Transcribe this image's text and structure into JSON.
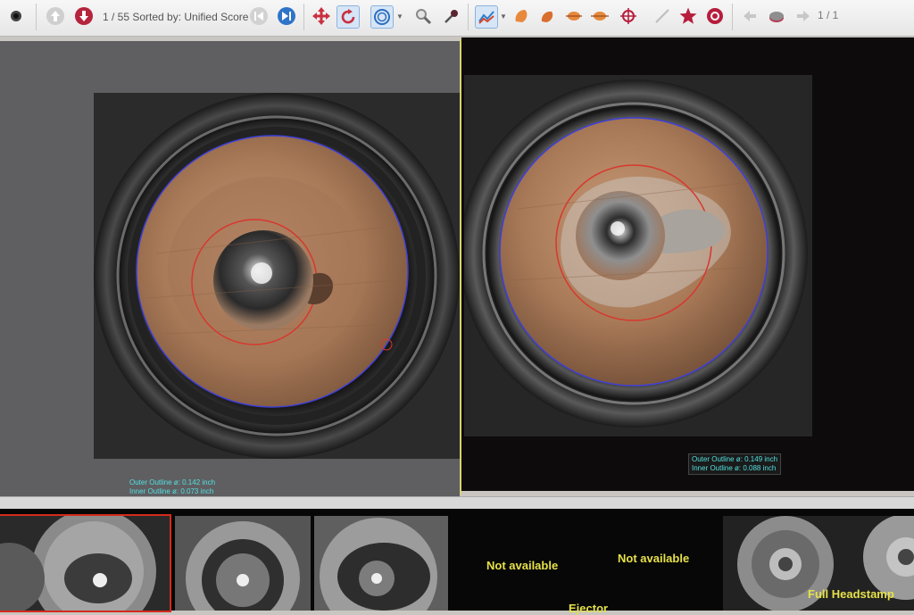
{
  "toolbar": {
    "status": "1 / 55 Sorted by: Unified Score",
    "page_count": "1 / 1",
    "icons": [
      "record-icon",
      "up-arrow-icon",
      "down-arrow-icon",
      "first-icon",
      "next-icon",
      "move-icon",
      "rotate-icon",
      "circle-outline-icon",
      "zoom-icon",
      "probe-icon",
      "chart-icon",
      "feature-icon",
      "feature-icon",
      "feature-icon",
      "feature-icon",
      "target-icon",
      "line-icon",
      "star-icon",
      "help-icon",
      "back-icon",
      "eraser-icon",
      "forward-icon"
    ],
    "colors": {
      "down_red": "#b5233d",
      "next_blue": "#2f74c8",
      "move_red": "#c8313f",
      "star_red": "#b61e3c",
      "feature_orange": "#e8883c"
    }
  },
  "left_scan": {
    "outer_outline": "Outer Outline ø: 0.142 inch",
    "inner_outline": "Inner Outline ø: 0.073 inch"
  },
  "right_scan": {
    "outer_outline": "Outer Outline ø: 0.149 inch",
    "inner_outline": "Inner Outline ø: 0.088 inch"
  },
  "thumbnails": {
    "not_available_1": "Not available",
    "not_available_2": "Not available",
    "ejector": "Ejector",
    "full_headstamp": "Full Headstamp"
  },
  "colors": {
    "outline_blue": "#3f3fd8",
    "outline_red": "#d8372e",
    "measure_text": "#54e0e0",
    "label_yellow": "#e6e14a",
    "primer_copper": "#a97a58"
  }
}
